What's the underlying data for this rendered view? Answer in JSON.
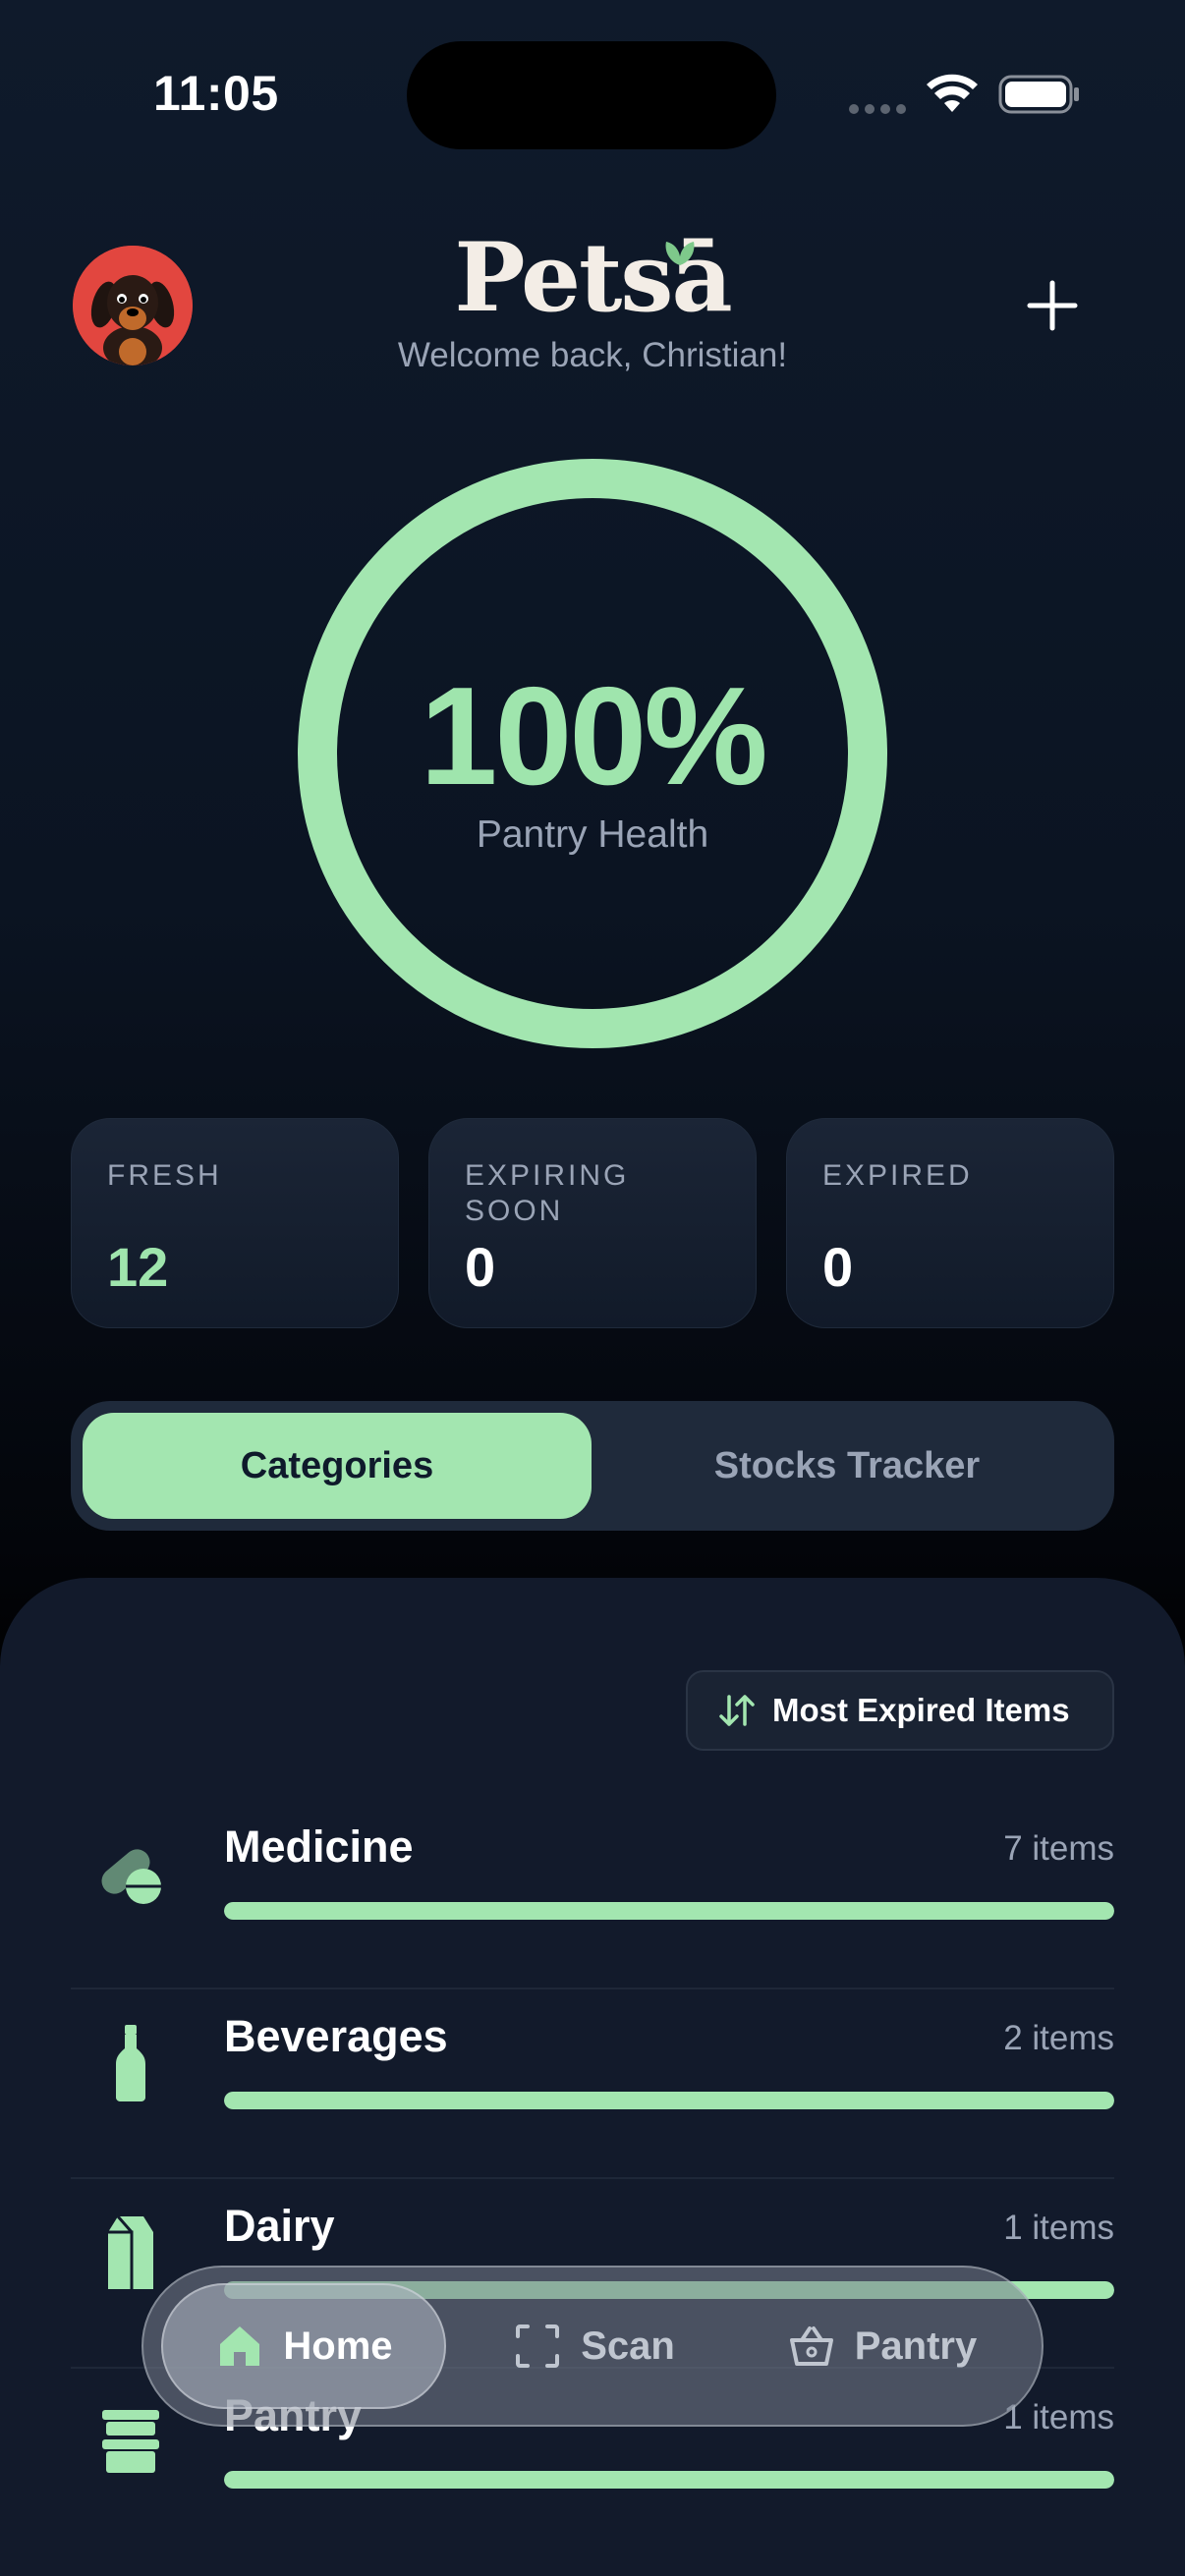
{
  "status_bar": {
    "time": "11:05"
  },
  "header": {
    "logo": "Petsā",
    "welcome": "Welcome back, Christian!"
  },
  "health": {
    "value": "100%",
    "label": "Pantry Health",
    "progress": 1.0,
    "color": "#a3e6b0"
  },
  "stats": [
    {
      "label": "FRESH",
      "value": "12"
    },
    {
      "label": "EXPIRING SOON",
      "value": "0"
    },
    {
      "label": "EXPIRED",
      "value": "0"
    }
  ],
  "segments": {
    "active": "Categories",
    "inactive": "Stocks Tracker"
  },
  "sort": {
    "label": "Most Expired Items"
  },
  "categories": [
    {
      "name": "Medicine",
      "count": "7 items",
      "icon": "pill-icon",
      "fill": 1.0
    },
    {
      "name": "Beverages",
      "count": "2 items",
      "icon": "bottle-icon",
      "fill": 1.0
    },
    {
      "name": "Dairy",
      "count": "1 items",
      "icon": "milk-carton-icon",
      "fill": 1.0
    },
    {
      "name": "Pantry",
      "count": "1 items",
      "icon": "container-icon",
      "fill": 1.0
    }
  ],
  "tabbar": {
    "home": "Home",
    "scan": "Scan",
    "pantry": "Pantry"
  },
  "colors": {
    "accent": "#a3e6b0",
    "background": "#0f1a2b",
    "sheet": "#121a2b",
    "avatar_bg": "#e2463f"
  }
}
